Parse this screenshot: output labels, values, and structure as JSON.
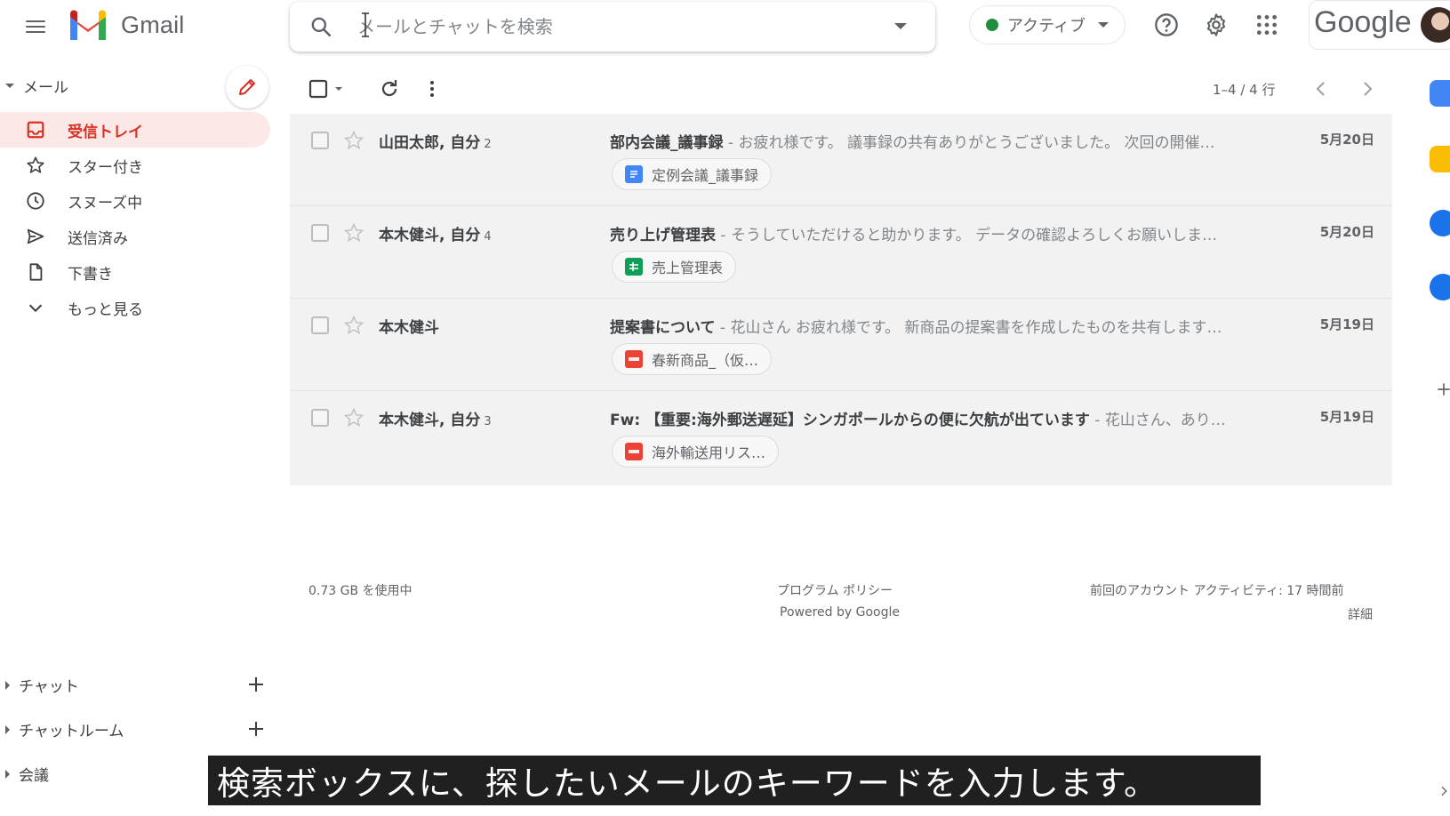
{
  "header": {
    "app_name": "Gmail",
    "search_placeholder": "メールとチャットを検索",
    "status_label": "アクティブ",
    "account_brand": "Google"
  },
  "sidebar": {
    "mail_section": "メール",
    "items": [
      {
        "label": "受信トレイ",
        "icon": "inbox-icon",
        "active": true
      },
      {
        "label": "スター付き",
        "icon": "star-icon"
      },
      {
        "label": "スヌーズ中",
        "icon": "clock-icon"
      },
      {
        "label": "送信済み",
        "icon": "send-icon"
      },
      {
        "label": "下書き",
        "icon": "draft-icon"
      },
      {
        "label": "もっと見る",
        "icon": "chevron-down-icon"
      }
    ],
    "chat_section": "チャット",
    "rooms_section": "チャットルーム",
    "meet_section": "会議"
  },
  "toolbar": {
    "pagination": "1–4 / 4 行"
  },
  "mails": [
    {
      "sender": "山田太郎, 自分",
      "count": "2",
      "subject": "部内会議_議事録",
      "snippet": " - お疲れ様です。 議事録の共有ありがとうございました。 次回の開催…",
      "date": "5月20日",
      "attachment": "定例会議_議事録",
      "attachment_type": "doc"
    },
    {
      "sender": "本木健斗, 自分",
      "count": "4",
      "subject": "売り上げ管理表",
      "snippet": " - そうしていただけると助かります。 データの確認よろしくお願いしま…",
      "date": "5月20日",
      "attachment": "売上管理表",
      "attachment_type": "sheet"
    },
    {
      "sender": "本木健斗",
      "count": "",
      "subject": "提案書について",
      "snippet": " - 花山さん お疲れ様です。 新商品の提案書を作成したものを共有します…",
      "date": "5月19日",
      "attachment": "春新商品_（仮…",
      "attachment_type": "pdf"
    },
    {
      "sender": "本木健斗, 自分",
      "count": "3",
      "subject": "Fw: 【重要:海外郵送遅延】シンガポールからの便に欠航が出ています",
      "snippet": " - 花山さん、あり…",
      "date": "5月19日",
      "attachment": "海外輸送用リス…",
      "attachment_type": "pdf"
    }
  ],
  "footer": {
    "storage": "0.73 GB を使用中",
    "policy": "プログラム ポリシー",
    "powered": "Powered by Google",
    "last_activity": "前回のアカウント アクティビティ: 17 時間前",
    "details": "詳細"
  },
  "caption": "検索ボックスに、探したいメールのキーワードを入力します。",
  "colors": {
    "accent_red": "#d93025",
    "active_bg": "#fce8e6",
    "status_green": "#1e8e3e",
    "doc_blue": "#4285f4",
    "sheet_green": "#0f9d58",
    "pdf_red": "#ea4335"
  }
}
